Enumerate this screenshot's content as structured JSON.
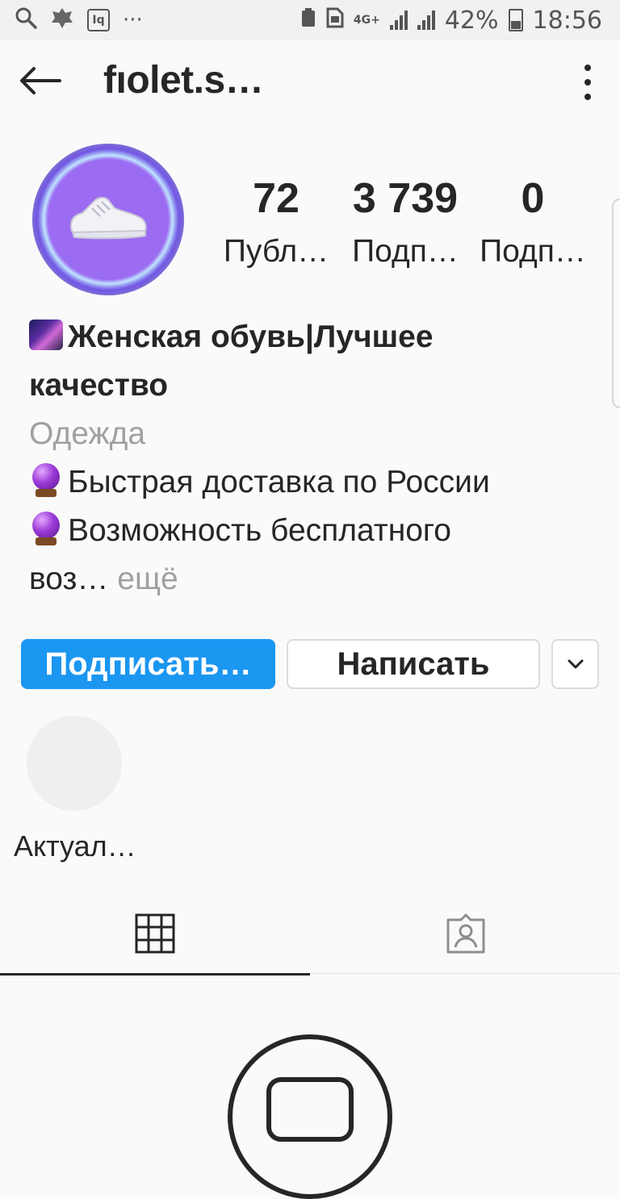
{
  "status_bar": {
    "network": "4G+",
    "battery": "42%",
    "time": "18:56"
  },
  "header": {
    "username": "fıolet.s…"
  },
  "stats": [
    {
      "value": "72",
      "label": "Публ…"
    },
    {
      "value": "3 739",
      "label": "Подп…"
    },
    {
      "value": "0",
      "label": "Подп…"
    }
  ],
  "bio": {
    "title_line1": "Женская обувь|Лучшее",
    "title_line2": "качество",
    "category": "Одежда",
    "line1": "Быстрая доставка по России",
    "line2": "Возможность бесплатного",
    "line3": "воз…",
    "more": "ещё"
  },
  "buttons": {
    "follow": "Подписать…",
    "message": "Написать"
  },
  "highlights": {
    "label": "Актуал…"
  },
  "colors": {
    "accent": "#1b96f1",
    "text": "#262626",
    "muted": "#a0a0a0",
    "background": "#fafafa"
  }
}
